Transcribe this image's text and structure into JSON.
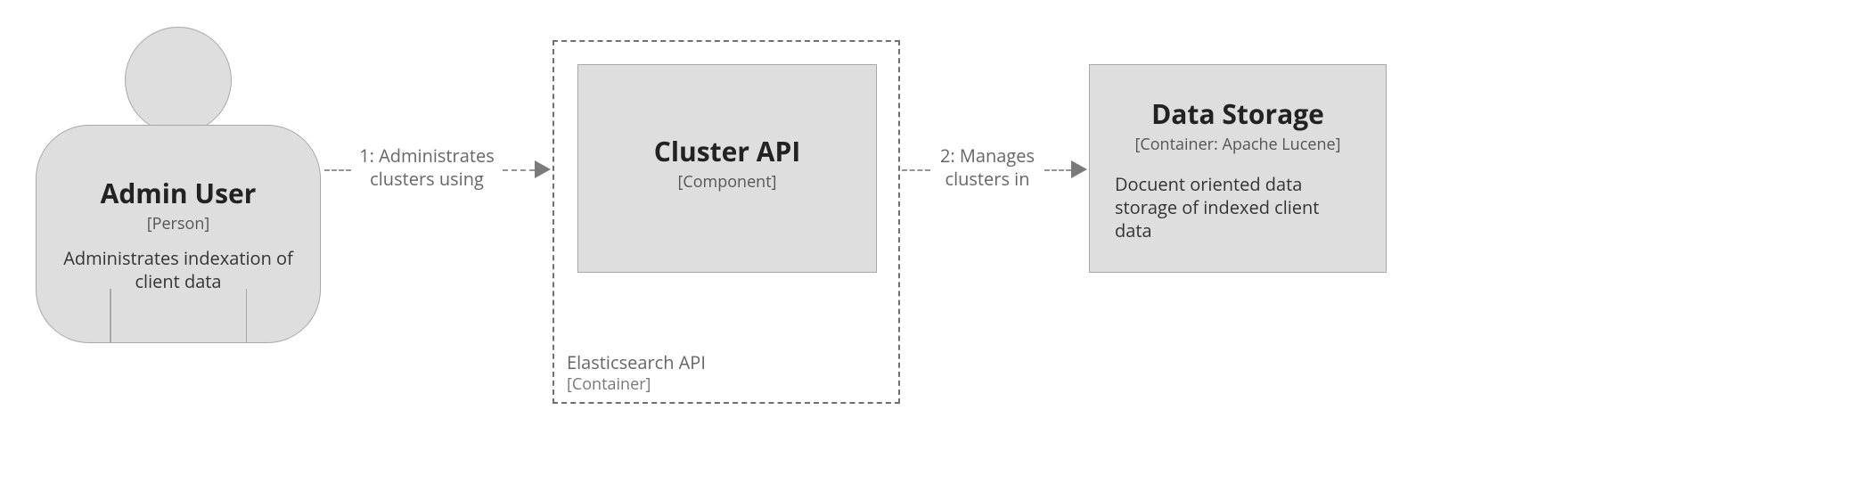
{
  "actor": {
    "title": "Admin User",
    "subtitle": "[Person]",
    "desc": "Administrates indexation of client data"
  },
  "container": {
    "title": "Elasticsearch API",
    "subtitle": "[Container]"
  },
  "component": {
    "title": "Cluster API",
    "subtitle": "[Component]"
  },
  "storage": {
    "title": "Data Storage",
    "subtitle": "[Container: Apache Lucene]",
    "desc": "Docuent oriented data storage of indexed client data"
  },
  "edge1": "1: Administrates clusters using",
  "edge2": "2: Manages clusters in"
}
